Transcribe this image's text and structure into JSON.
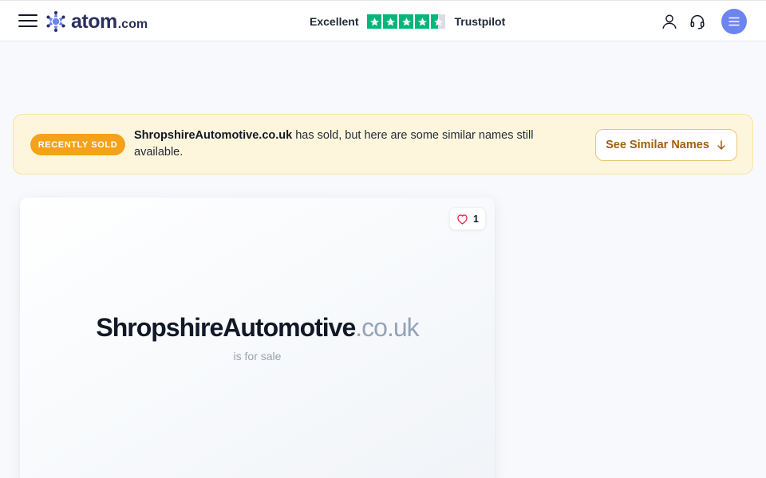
{
  "header": {
    "logo_text": "atom",
    "logo_suffix": ".com",
    "rating_label": "Excellent",
    "rating_stars": 4.5,
    "rating_provider": "Trustpilot"
  },
  "banner": {
    "badge": "RECENTLY SOLD",
    "domain": "ShropshireAutomotive.co.uk",
    "message": " has sold, but here are some similar names still available.",
    "button_label": "See Similar Names"
  },
  "card": {
    "likes": "1",
    "domain_name": "ShropshireAutomotive",
    "domain_tld": ".co.uk",
    "subtitle": "is for sale"
  },
  "colors": {
    "brand": "#2b2f5c",
    "accent": "#6b84f0",
    "trustpilot_green": "#00b67a",
    "badge_orange": "#f4a21a",
    "banner_bg": "#fef6dc"
  },
  "icons": {
    "menu": "hamburger-icon",
    "account": "user-icon",
    "support": "headset-icon",
    "nav": "menu-lines-icon",
    "like": "heart-icon",
    "arrow": "arrow-down-icon"
  }
}
